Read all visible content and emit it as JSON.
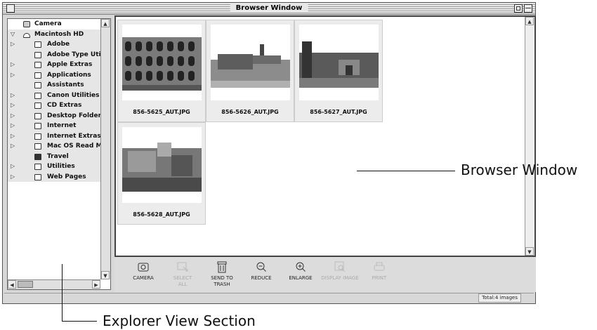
{
  "window": {
    "title": "Browser Window"
  },
  "explorer": {
    "items": [
      {
        "label": "Camera",
        "expander": "",
        "icon": "camera",
        "shaded": false,
        "indent": 0
      },
      {
        "label": "Macintosh HD",
        "expander": "▽",
        "icon": "disk",
        "shaded": true,
        "indent": 0
      },
      {
        "label": "Adobe",
        "expander": "▷",
        "icon": "folder",
        "shaded": true,
        "indent": 1
      },
      {
        "label": "Adobe Type Utilit",
        "expander": "",
        "icon": "folder",
        "shaded": true,
        "indent": 1
      },
      {
        "label": "Apple Extras",
        "expander": "▷",
        "icon": "folder",
        "shaded": true,
        "indent": 1
      },
      {
        "label": "Applications",
        "expander": "▷",
        "icon": "folder",
        "shaded": true,
        "indent": 1
      },
      {
        "label": "Assistants",
        "expander": "",
        "icon": "folder",
        "shaded": true,
        "indent": 1
      },
      {
        "label": "Canon Utilities",
        "expander": "▷",
        "icon": "folder",
        "shaded": true,
        "indent": 1
      },
      {
        "label": "CD Extras",
        "expander": "▷",
        "icon": "folder",
        "shaded": true,
        "indent": 1
      },
      {
        "label": "Desktop Folder",
        "expander": "▷",
        "icon": "folder",
        "shaded": true,
        "indent": 1
      },
      {
        "label": "Internet",
        "expander": "▷",
        "icon": "folder",
        "shaded": true,
        "indent": 1
      },
      {
        "label": "Internet Extras",
        "expander": "▷",
        "icon": "folder",
        "shaded": true,
        "indent": 1
      },
      {
        "label": "Mac OS Read Me I",
        "expander": "▷",
        "icon": "folder",
        "shaded": true,
        "indent": 1
      },
      {
        "label": "Travel",
        "expander": "",
        "icon": "folder-dark",
        "shaded": true,
        "indent": 1
      },
      {
        "label": "Utilities",
        "expander": "▷",
        "icon": "folder",
        "shaded": true,
        "indent": 1
      },
      {
        "label": "Web Pages",
        "expander": "▷",
        "icon": "folder",
        "shaded": true,
        "indent": 1
      }
    ]
  },
  "thumbnails": [
    {
      "filename": "856-5625_AUT.JPG",
      "scene": "colosseum"
    },
    {
      "filename": "856-5626_AUT.JPG",
      "scene": "forum"
    },
    {
      "filename": "856-5627_AUT.JPG",
      "scene": "arch"
    },
    {
      "filename": "856-5628_AUT.JPG",
      "scene": "ruins"
    }
  ],
  "toolbar": {
    "buttons": [
      {
        "label": "CAMERA",
        "icon": "camera-icon",
        "enabled": true
      },
      {
        "label": "SELECT\nALL",
        "icon": "select-all-icon",
        "enabled": false
      },
      {
        "label": "SEND TO\nTRASH",
        "icon": "trash-icon",
        "enabled": true
      },
      {
        "label": "REDUCE",
        "icon": "zoom-out-icon",
        "enabled": true
      },
      {
        "label": "ENLARGE",
        "icon": "zoom-in-icon",
        "enabled": true
      },
      {
        "label": "DISPLAY IMAGE",
        "icon": "display-image-icon",
        "enabled": false
      },
      {
        "label": "PRINT",
        "icon": "print-icon",
        "enabled": false
      }
    ]
  },
  "status": {
    "total": "Total:4 images"
  },
  "callouts": {
    "browser": "Browser Window",
    "explorer": "Explorer View Section"
  }
}
